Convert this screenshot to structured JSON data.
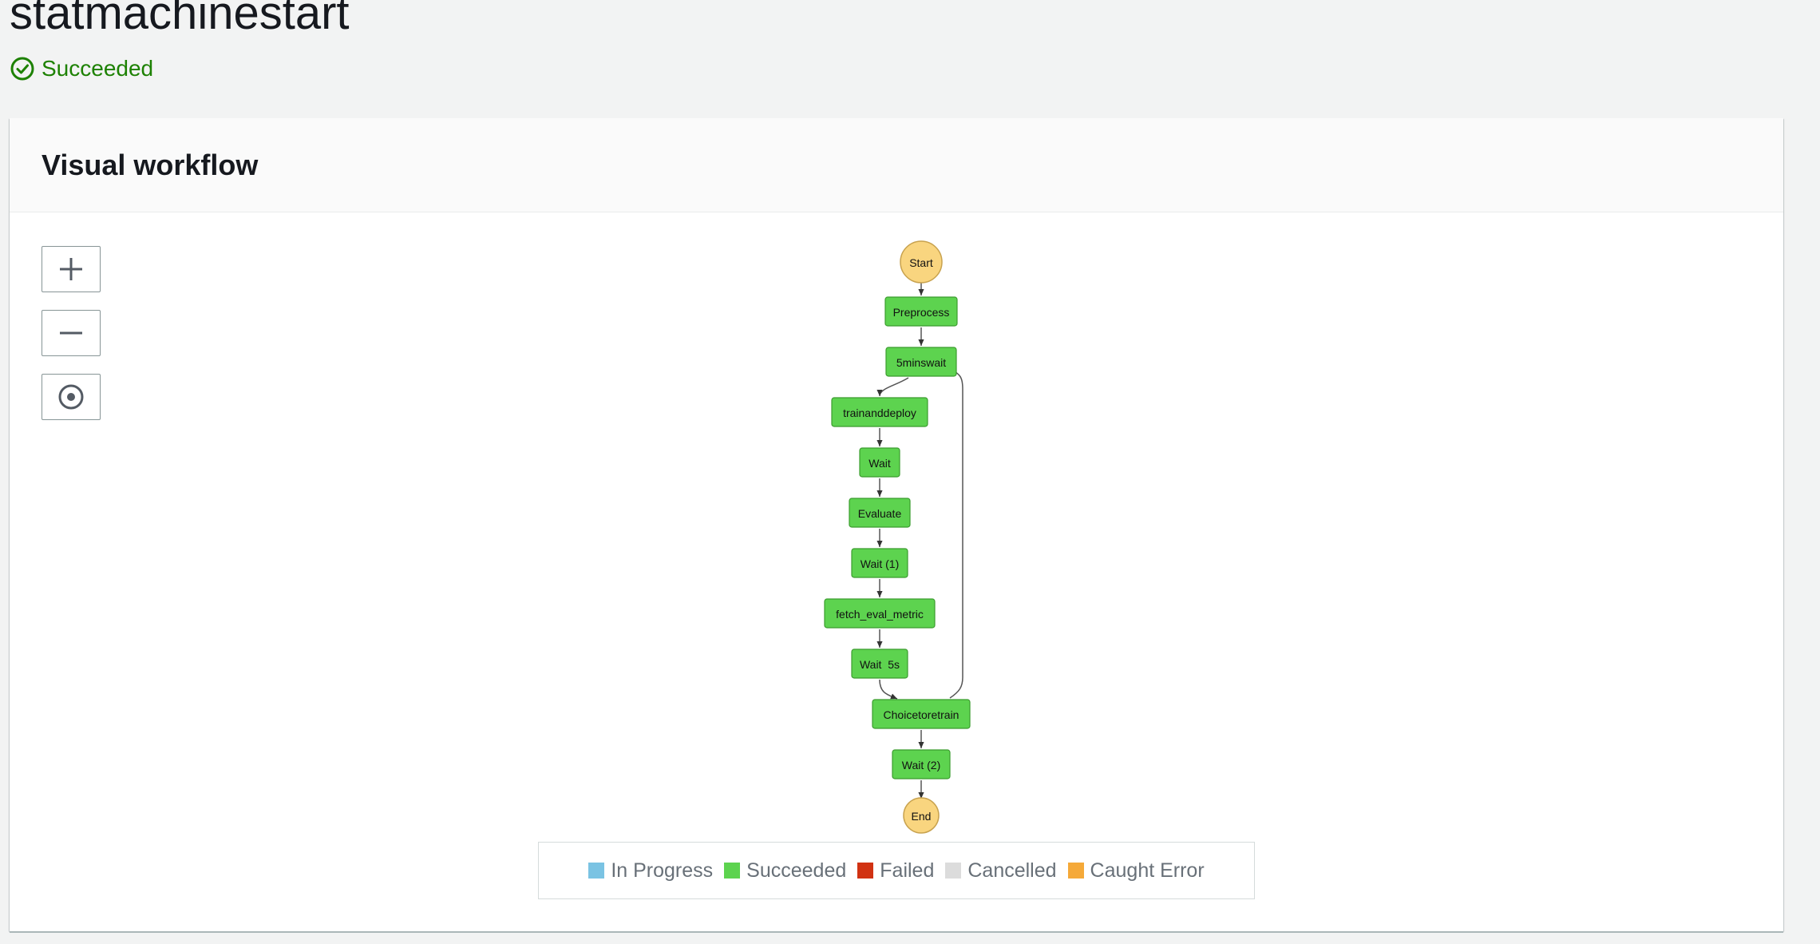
{
  "page": {
    "title": "statmachinestart",
    "status": "Succeeded"
  },
  "panel": {
    "title": "Visual workflow"
  },
  "controls": {
    "zoom_in": "zoom-in-icon",
    "zoom_out": "zoom-out-icon",
    "center": "center-icon"
  },
  "workflow": {
    "start": "Start",
    "end": "End",
    "states": [
      {
        "label": "Preprocess",
        "status": "Succeeded"
      },
      {
        "label": "5minswait",
        "status": "Succeeded"
      },
      {
        "label": "trainanddeploy",
        "status": "Succeeded"
      },
      {
        "label": "Wait",
        "status": "Succeeded"
      },
      {
        "label": "Evaluate",
        "status": "Succeeded"
      },
      {
        "label": "Wait (1)",
        "status": "Succeeded"
      },
      {
        "label": "fetch_eval_metric",
        "status": "Succeeded"
      },
      {
        "label": "Wait  5s",
        "status": "Succeeded"
      },
      {
        "label": "Choicetoretrain",
        "status": "Succeeded"
      },
      {
        "label": "Wait (2)",
        "status": "Succeeded"
      }
    ]
  },
  "legend": [
    {
      "label": "In Progress",
      "color": "#7ac3e3"
    },
    {
      "label": "Succeeded",
      "color": "#5dd34f"
    },
    {
      "label": "Failed",
      "color": "#d13212"
    },
    {
      "label": "Cancelled",
      "color": "#dcdcdc"
    },
    {
      "label": "Caught Error",
      "color": "#f5a939"
    }
  ],
  "colors": {
    "succeeded": "#5dd34f",
    "terminal": "#f9d57f",
    "status_green": "#1d8102"
  }
}
